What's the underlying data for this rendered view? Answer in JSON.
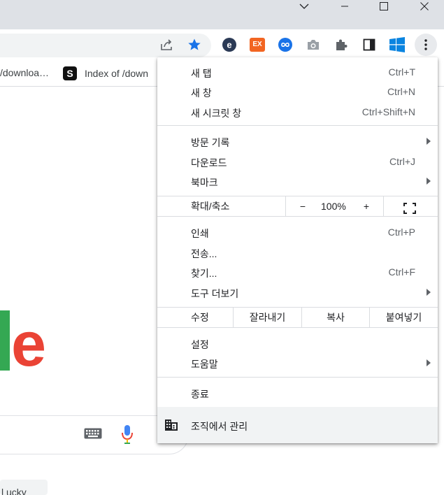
{
  "window_controls": {
    "chevron": "chevron-down-icon",
    "minimize": "minimize-icon",
    "maximize": "maximize-icon",
    "close": "close-icon"
  },
  "toolbar_icons": [
    "share-icon",
    "star-icon",
    "extension-e-icon",
    "extension-ex-icon",
    "extension-infinity-icon",
    "camera-icon",
    "puzzle-icon",
    "sidepanel-icon",
    "windows-icon",
    "kebab-menu-icon"
  ],
  "extension_ex_label": "EX",
  "bookmarks": [
    {
      "label": "/downloa…"
    },
    {
      "label": "Index of /down",
      "icon_letter": "S"
    }
  ],
  "menu": {
    "new_tab": {
      "label": "새 탭",
      "shortcut": "Ctrl+T"
    },
    "new_window": {
      "label": "새 창",
      "shortcut": "Ctrl+N"
    },
    "incognito": {
      "label": "새 시크릿 창",
      "shortcut": "Ctrl+Shift+N"
    },
    "history": {
      "label": "방문 기록"
    },
    "downloads": {
      "label": "다운로드",
      "shortcut": "Ctrl+J"
    },
    "bookmarks": {
      "label": "북마크"
    },
    "zoom": {
      "label": "확대/축소",
      "minus": "−",
      "value": "100%",
      "plus": "+"
    },
    "print": {
      "label": "인쇄",
      "shortcut": "Ctrl+P"
    },
    "cast": {
      "label": "전송..."
    },
    "find": {
      "label": "찾기...",
      "shortcut": "Ctrl+F"
    },
    "more_tools": {
      "label": "도구 더보기"
    },
    "edit": {
      "label": "수정",
      "cut": "잘라내기",
      "copy": "복사",
      "paste": "붙여넣기"
    },
    "settings": {
      "label": "설정"
    },
    "help": {
      "label": "도움말"
    },
    "exit": {
      "label": "종료"
    },
    "managed": {
      "label": "조직에서 관리"
    }
  },
  "page": {
    "bottom_chip": "l ucky"
  },
  "colors": {
    "accent_blue": "#1a73e8",
    "google_green": "#34a853",
    "google_red": "#ea4335"
  }
}
